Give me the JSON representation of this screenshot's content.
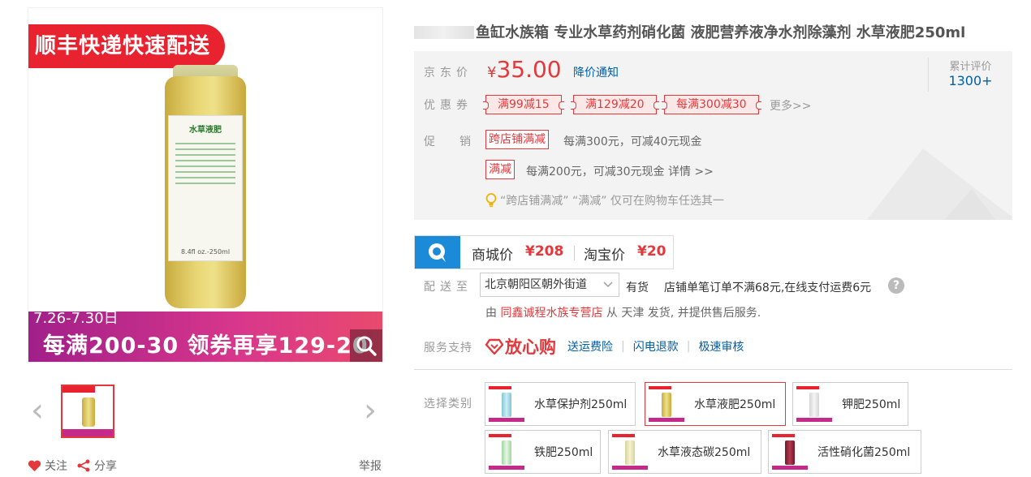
{
  "gallery": {
    "banner_top": "顺丰快递快速配送",
    "label_title": "水草液肥",
    "label_foot": "8.4fl oz.-250ml",
    "banner_date": "7.26-7.30日",
    "banner_promo": "每满200-30 领券再享129-20",
    "prev_arrow": "‹",
    "next_arrow": "›",
    "follow": "关注",
    "share": "分享",
    "report": "举报"
  },
  "product": {
    "title": "鱼缸水族箱 专业水草药剂硝化菌 液肥营养液净水剂除藻剂 水草液肥250ml"
  },
  "summary": {
    "price_label": "京东价",
    "currency": "¥",
    "price": "35.00",
    "price_notice": "降价通知",
    "rating_label": "累计评价",
    "rating_value": "1300+",
    "coupon_label": "优惠券",
    "coupons": [
      "满99减15",
      "满129减20",
      "每满300减30"
    ],
    "more": "更多>>",
    "promo_label": "促销",
    "promo1_tag": "跨店铺满减",
    "promo1_text": "每满300元，可减40元现金",
    "promo2_tag": "满减",
    "promo2_text": "每满200元，可减30元现金 详情 >>",
    "tip": "“跨店铺满减” “满减” 仅可在购物车任选其一"
  },
  "compare": {
    "mall_label": "商城价",
    "mall_price": "¥208",
    "taobao_label": "淘宝价",
    "taobao_price": "¥20"
  },
  "delivery": {
    "label": "配送至",
    "address": "北京朝阳区朝外街道",
    "stock": "有货",
    "freight": "店铺单笔订单不满68元,在线支付运费6元",
    "help": "?",
    "seller_prefix": "由",
    "store": "同鑫诚程水族专营店",
    "seller_suffix": "从 天津 发货, 并提供售后服务."
  },
  "service": {
    "label": "服务支持",
    "fangxingou": "放心购",
    "items": [
      "送运费险",
      "闪电退款",
      "极速审核"
    ]
  },
  "variants": {
    "label": "选择类别",
    "items": [
      "水草保护剂250ml",
      "水草液肥250ml",
      "钾肥250ml",
      "铁肥250ml",
      "水草液态碳250ml",
      "活性硝化菌250ml"
    ],
    "selected": "水草液肥250ml"
  },
  "colors": {
    "accent": "#e4393c",
    "link": "#005ea7"
  }
}
